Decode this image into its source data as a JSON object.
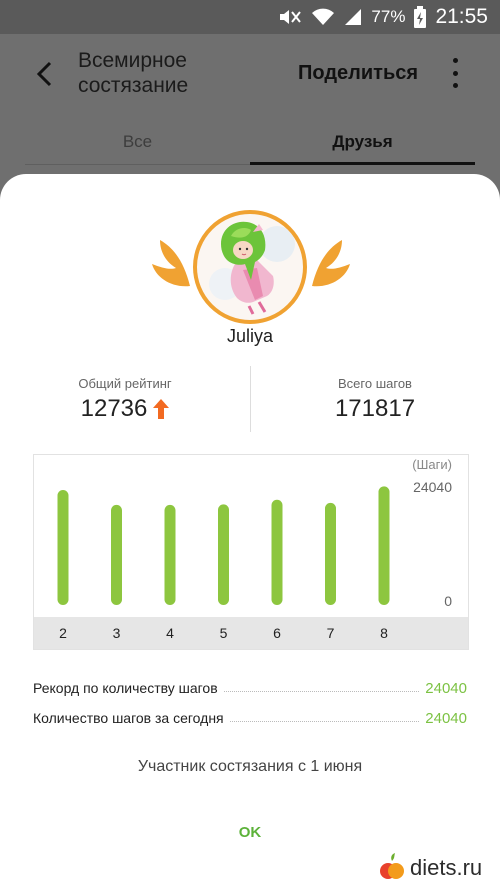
{
  "status_bar": {
    "battery_percent": "77%",
    "time": "21:55",
    "icons": [
      "mute-icon",
      "wifi-icon",
      "signal-icon",
      "battery-charging-icon"
    ]
  },
  "app_bar": {
    "title": "Всемирное состязание",
    "share_label": "Поделиться"
  },
  "tabs": [
    {
      "label": "Все",
      "active": false
    },
    {
      "label": "Друзья",
      "active": true
    }
  ],
  "profile": {
    "name": "Juliya"
  },
  "stats": {
    "rating_label": "Общий рейтинг",
    "rating_value": "12736",
    "rating_trend": "up",
    "steps_label": "Всего шагов",
    "steps_value": "171817"
  },
  "chart_data": {
    "type": "bar",
    "categories": [
      "2",
      "3",
      "4",
      "5",
      "6",
      "7",
      "8"
    ],
    "values": [
      22300,
      19400,
      19400,
      19500,
      20400,
      19800,
      23000
    ],
    "ylabel": "(Шаги)",
    "ylim": [
      0,
      24040
    ],
    "y_ticks": [
      "24040",
      "0"
    ],
    "bar_color": "#8dc63f"
  },
  "records": {
    "record_label": "Рекорд по количеству шагов",
    "record_value": "24040",
    "today_label": "Количество шагов за сегодня",
    "today_value": "24040"
  },
  "member_since": "Участник состязания с 1 июня",
  "ok_label": "OK",
  "watermark": "diets.ru",
  "colors": {
    "accent_green": "#7cc243",
    "bar_green": "#8dc63f",
    "wing_orange": "#f0a232",
    "up_arrow": "#f26a21"
  }
}
